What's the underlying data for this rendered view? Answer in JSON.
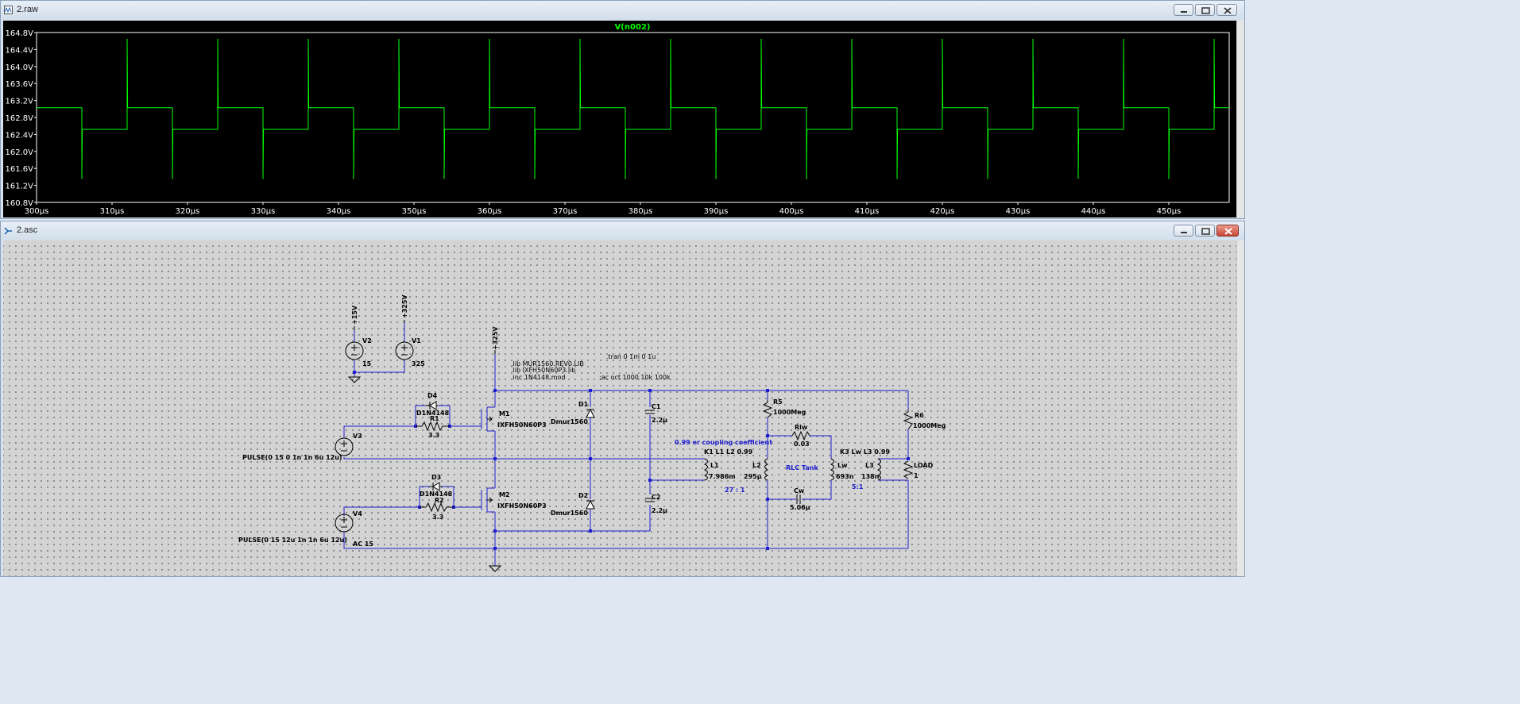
{
  "waveform_window": {
    "title": "2.raw",
    "trace_label": "V(n002)",
    "trace_color": "#00ff00",
    "chart_data": {
      "type": "line",
      "title": "",
      "xlabel": "",
      "ylabel": "",
      "xlim": [
        300,
        458
      ],
      "ylim": [
        160.8,
        164.8
      ],
      "y_ticks": [
        "164.8V",
        "164.4V",
        "164.0V",
        "163.6V",
        "163.2V",
        "162.8V",
        "162.4V",
        "162.0V",
        "161.6V",
        "161.2V",
        "160.8V"
      ],
      "x_ticks": [
        "300µs",
        "310µs",
        "320µs",
        "330µs",
        "340µs",
        "350µs",
        "360µs",
        "370µs",
        "380µs",
        "390µs",
        "400µs",
        "410µs",
        "420µs",
        "430µs",
        "440µs",
        "450µs"
      ],
      "series": [
        {
          "high_level": 163.03,
          "low_level": 162.52,
          "period_us": 12,
          "first_fall_us": 306,
          "spike_high": 164.65,
          "spike_low": 161.35
        }
      ],
      "grid": false,
      "legend": "none"
    }
  },
  "schematic_window": {
    "title": "2.asc",
    "labels": {
      "v2_name": "V2",
      "v2_value": "15",
      "v2_net": "+15V",
      "v1_name": "V1",
      "v1_value": "325",
      "v1_net": "+325V",
      "hv_net": "+325V",
      "lib1": ".lib MUR1560.REV0.LIB",
      "lib2": ".lib IXFH50N60P3.lib",
      "inc1": ".inc 1N4148.mod",
      "tran": ".tran 0 1m 0 1u",
      "ac": ";ac oct 1000 10k 100k",
      "d4": "D4",
      "d4_model": "D1N4148",
      "r1": "R1",
      "r1_value": "3.3",
      "d3": "D3",
      "d3_model": "D1N4148",
      "r2": "R2",
      "r2_value": "3.3",
      "m1": "M1",
      "m1_model": "IXFH50N60P3",
      "m2": "M2",
      "m2_model": "IXFH50N60P3",
      "v3": "V3",
      "v3_value": "PULSE(0 15 0 1n 1n 6u 12u)",
      "v4": "V4",
      "v4_value": "PULSE(0 15 12u 1n 1n 6u 12u)",
      "v4_ac": "AC 15",
      "d1": "D1",
      "d1_model": "Dmur1560",
      "d2": "D2",
      "d2_model": "Dmur1560",
      "c1": "C1",
      "c1_value": "2.2µ",
      "c2": "C2",
      "c2_value": "2.2µ",
      "coupling_note": "0.99 er coupling coefficient",
      "k1": "K1 L1 L2 0.99",
      "l1": "L1",
      "l1_value": "7.986m",
      "l2": "L2",
      "l2_value": "295µ",
      "ratio1": "27 : 1",
      "r5": "R5",
      "r5_value": "1000Meg",
      "rlw": "Rlw",
      "rlw_value": "0.03",
      "rlc": "RLC Tank",
      "lw": "Lw",
      "lw_value": "693n",
      "cw": "Cw",
      "cw_value": "5.06µ",
      "k3": "K3 Lw L3 0.99",
      "l3": "L3",
      "l3_value": "138n",
      "ratio2": "5:1",
      "r6": "R6",
      "r6_value": "1000Meg",
      "load": "LOAD",
      "load_value": "1"
    }
  }
}
